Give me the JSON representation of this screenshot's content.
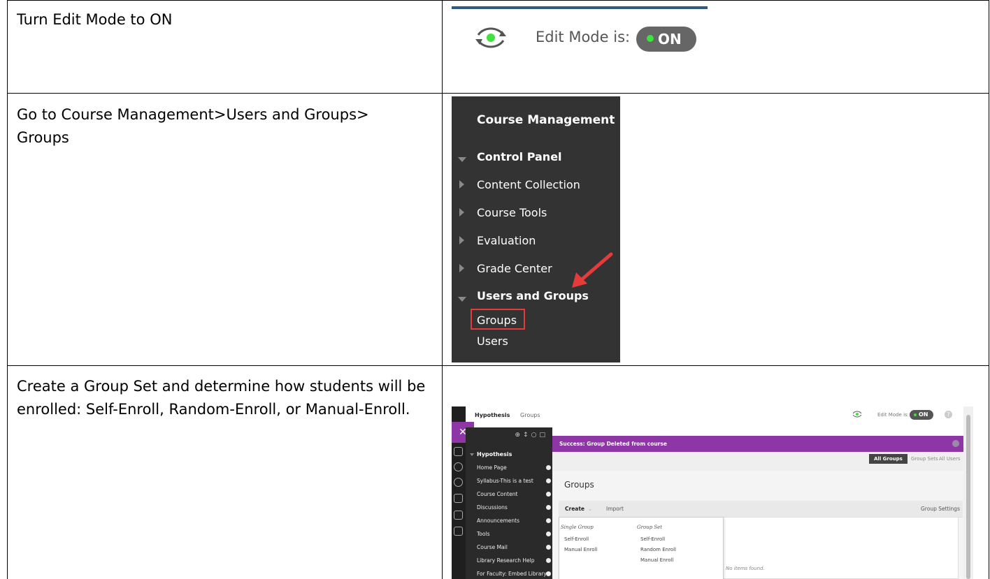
{
  "rows": [
    {
      "instruction": "Turn Edit Mode to ON",
      "edit_mode": {
        "label": "Edit Mode is:",
        "state": "ON",
        "indicator_color": "#3ee33e",
        "toggle_color": "#666666"
      }
    },
    {
      "instruction": "Go to Course Management>Users and Groups> Groups",
      "course_management": {
        "title": "Course Management",
        "items": [
          {
            "label": "Control Panel",
            "expanded": true
          },
          {
            "label": "Content Collection",
            "expanded": false
          },
          {
            "label": "Course Tools",
            "expanded": false
          },
          {
            "label": "Evaluation",
            "expanded": false
          },
          {
            "label": "Grade Center",
            "expanded": false
          },
          {
            "label": "Users and Groups",
            "expanded": true
          }
        ],
        "subitems": [
          "Groups",
          "Users"
        ],
        "highlight_color": "#e53b3b"
      }
    },
    {
      "instruction": "Create a Group Set and determine how students will be enrolled: Self-Enroll, Random-Enroll, or Manual-Enroll.",
      "blackboard": {
        "course_title": "Hypothesis",
        "breadcrumb": "Groups",
        "edit_mode_label": "Edit Mode is:",
        "edit_mode_state": "ON",
        "help": "?",
        "banner": "Success: Group Deleted from course",
        "banner_color": "#8f36a6",
        "tabs": [
          "All Groups",
          "Group Sets",
          "All Users"
        ],
        "heading": "Groups",
        "actions": {
          "create": "Create",
          "import": "Import",
          "settings": "Group Settings"
        },
        "empty_message": "No items found.",
        "nav": {
          "header": "Hypothesis",
          "items": [
            "Home Page",
            "Syllabus-This is a test",
            "Course Content",
            "Discussions",
            "Announcements",
            "Tools",
            "Course Mail",
            "Library Research Help",
            "For Faculty: Embed Library"
          ]
        },
        "create_menu": {
          "single_group": {
            "heading": "Single Group",
            "items": [
              "Self-Enroll",
              "Manual Enroll"
            ]
          },
          "group_set": {
            "heading": "Group Set",
            "items": [
              "Self-Enroll",
              "Random Enroll",
              "Manual Enroll"
            ]
          }
        }
      }
    }
  ]
}
